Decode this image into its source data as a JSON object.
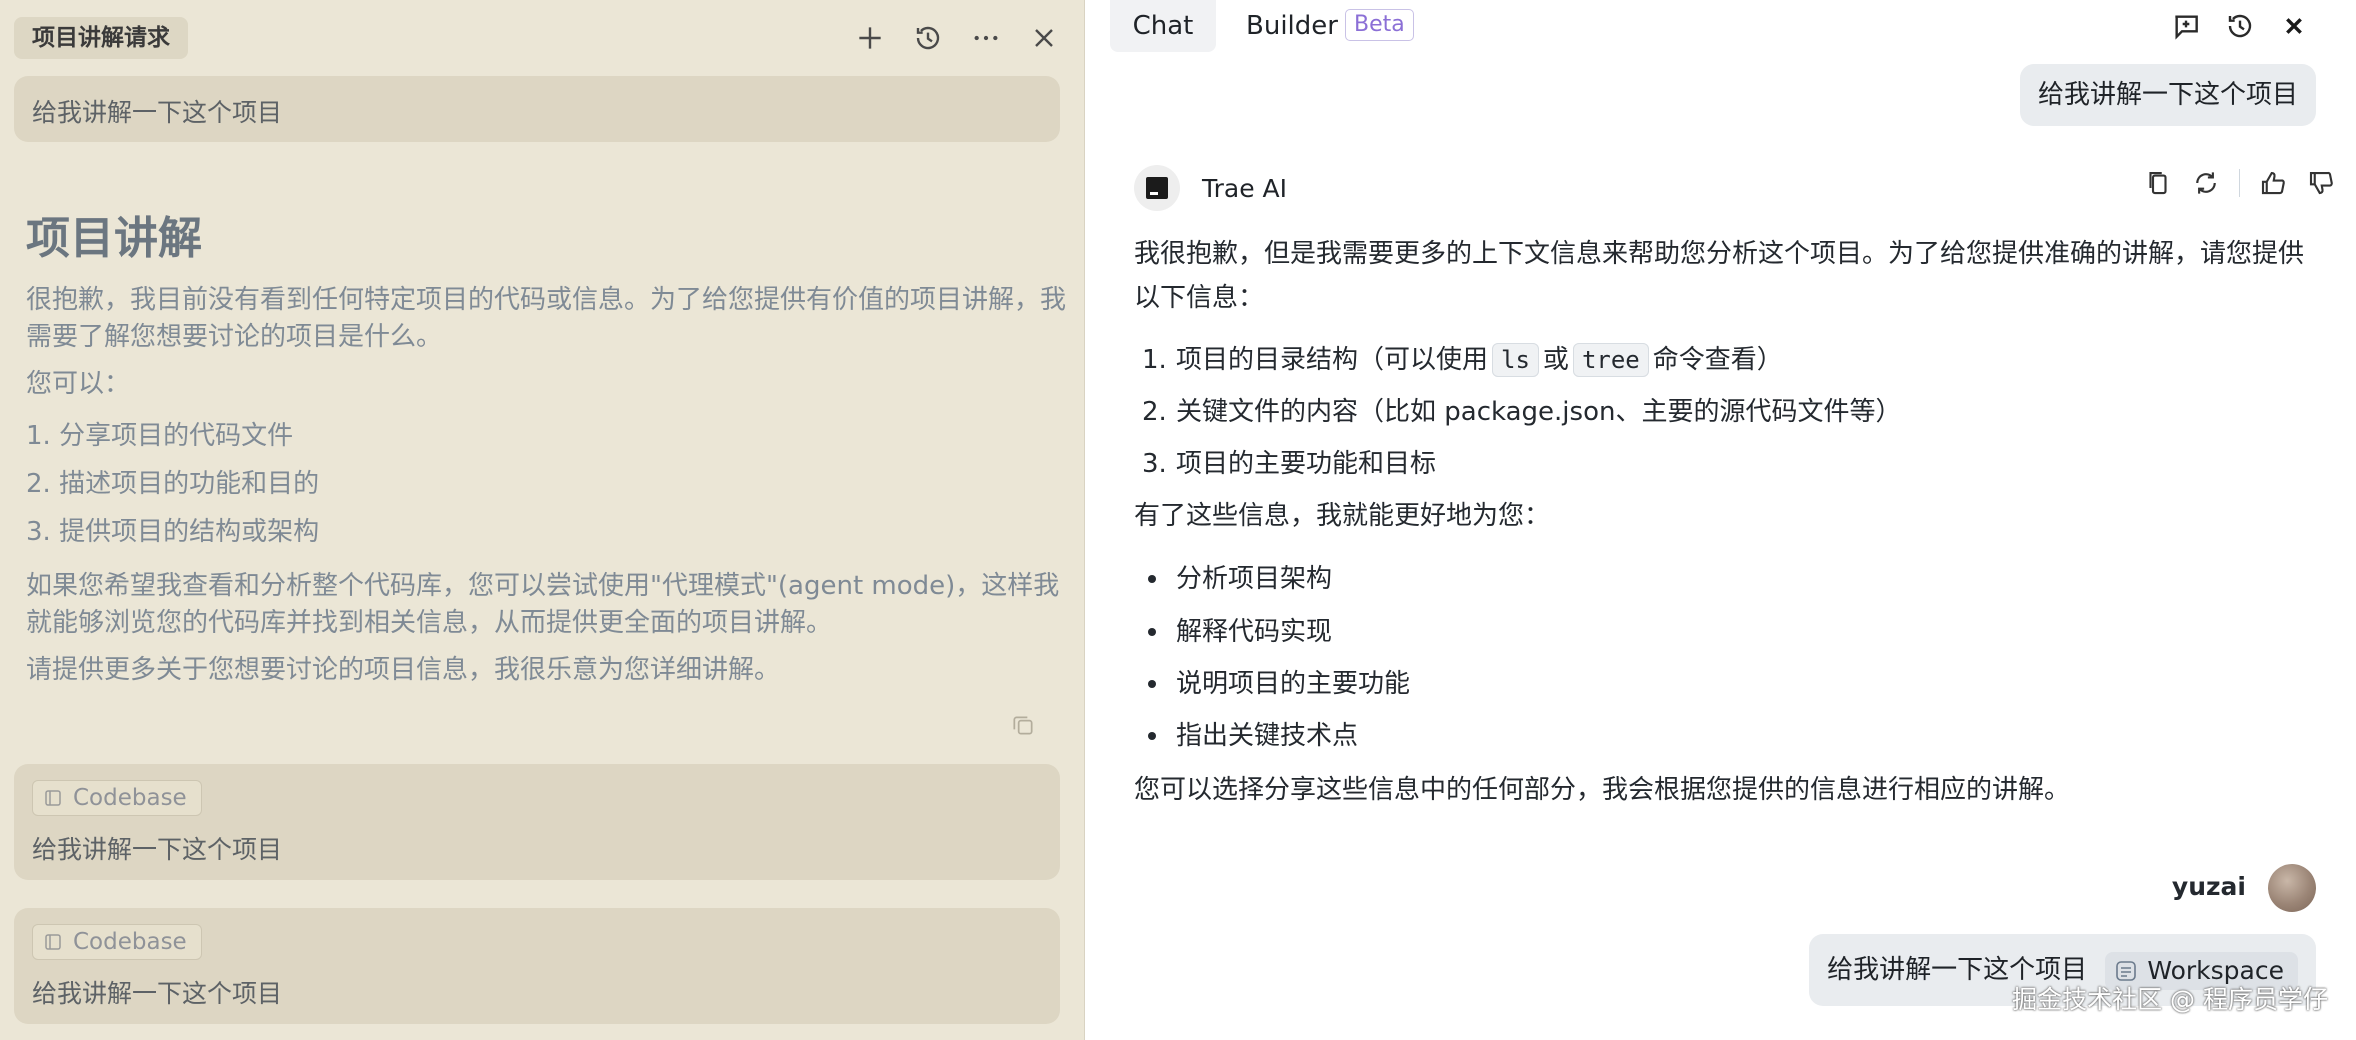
{
  "left": {
    "title": "项目讲解请求",
    "first_message": "给我讲解一下这个项目",
    "heading": "项目讲解",
    "para1": "很抱歉，我目前没有看到任何特定项目的代码或信息。为了给您提供有价值的项目讲解，我需要了解您想要讨论的项目是什么。",
    "para2": "您可以：",
    "list": [
      "1. 分享项目的代码文件",
      "2. 描述项目的功能和目的",
      "3. 提供项目的结构或架构"
    ],
    "para3": "如果您希望我查看和分析整个代码库，您可以尝试使用\"代理模式\"(agent mode)，这样我就能够浏览您的代码库并找到相关信息，从而提供更全面的项目讲解。",
    "para4": "请提供更多关于您想要讨论的项目信息，我很乐意为您详细讲解。",
    "cards": [
      {
        "chip": "Codebase",
        "text": "给我讲解一下这个项目"
      },
      {
        "chip": "Codebase",
        "text": "给我讲解一下这个项目"
      }
    ]
  },
  "right": {
    "tabs": {
      "chat": "Chat",
      "builder": "Builder",
      "beta": "Beta"
    },
    "user_msg_top": "给我讲解一下这个项目",
    "ai_name": "Trae AI",
    "ai_intro": "我很抱歉，但是我需要更多的上下文信息来帮助您分析这个项目。为了给您提供准确的讲解，请您提供以下信息：",
    "ol": [
      {
        "num": "1.",
        "before": "项目的目录结构（可以使用",
        "code1": "ls",
        "mid": "或",
        "code2": "tree",
        "after": "命令查看）"
      },
      {
        "num": "2.",
        "text": "关键文件的内容（比如 package.json、主要的源代码文件等）"
      },
      {
        "num": "3.",
        "text": "项目的主要功能和目标"
      }
    ],
    "after_ol": "有了这些信息，我就能更好地为您：",
    "ul": [
      "分析项目架构",
      "解释代码实现",
      "说明项目的主要功能",
      "指出关键技术点"
    ],
    "closing": "您可以选择分享这些信息中的任何部分，我会根据您提供的信息进行相应的讲解。",
    "user_name": "yuzai",
    "user_msg_bottom": "给我讲解一下这个项目",
    "workspace_chip": "Workspace",
    "watermark": "掘金技术社区 @ 程序员学仔"
  }
}
